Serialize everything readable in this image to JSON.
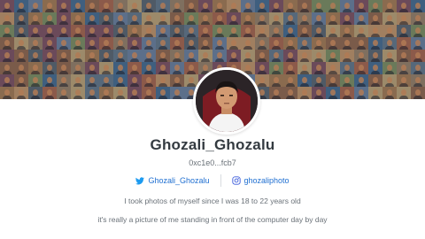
{
  "profile": {
    "name": "Ghozali_Ghozalu",
    "address": "0xc1e0...fcb7"
  },
  "socials": {
    "twitter": {
      "label": "Ghozali_Ghozalu",
      "icon": "twitter-icon"
    },
    "instagram": {
      "label": "ghozaliphoto",
      "icon": "instagram-icon"
    }
  },
  "bio": [
    "I took photos of myself since I was 18 to 22 years old",
    "it's really a picture of me standing in front of the computer day by day"
  ],
  "colors": {
    "link": "#1f6fd1",
    "name": "#333a40",
    "muted": "#6a7178"
  }
}
